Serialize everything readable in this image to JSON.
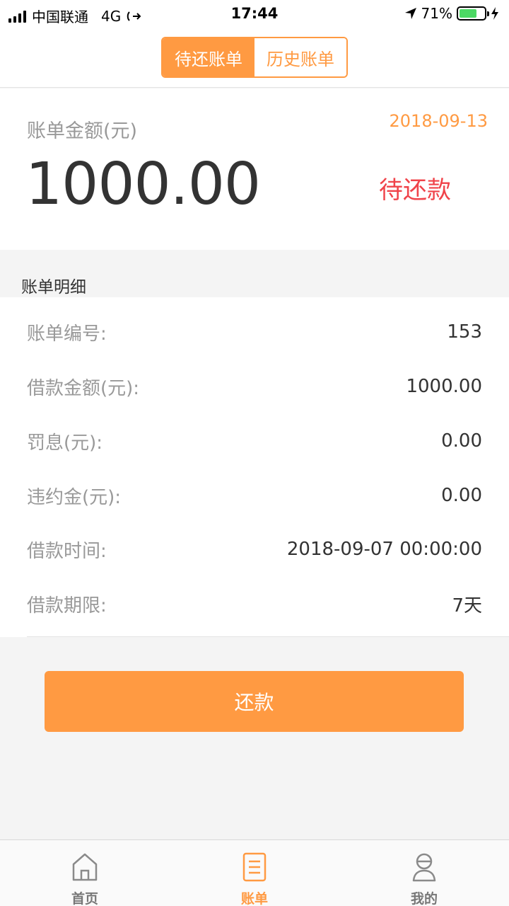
{
  "status_bar": {
    "carrier": "中国联通",
    "network": "4G",
    "time": "17:44",
    "battery_percent": "71%",
    "battery_level": 0.71,
    "battery_color": "#4cd964"
  },
  "header": {
    "tabs": [
      {
        "label": "待还账单",
        "active": true
      },
      {
        "label": "历史账单",
        "active": false
      }
    ]
  },
  "summary": {
    "label": "账单金额(元)",
    "date": "2018-09-13",
    "amount": "1000.00",
    "status": "待还款"
  },
  "details": {
    "title": "账单明细",
    "rows": [
      {
        "label": "账单编号:",
        "value": "153"
      },
      {
        "label": "借款金额(元):",
        "value": "1000.00"
      },
      {
        "label": "罚息(元):",
        "value": "0.00"
      },
      {
        "label": "违约金(元):",
        "value": "0.00"
      },
      {
        "label": "借款时间:",
        "value": "2018-09-07 00:00:00"
      },
      {
        "label": "借款期限:",
        "value": "7天"
      }
    ]
  },
  "action": {
    "repay_label": "还款"
  },
  "tabbar": {
    "items": [
      {
        "label": "首页",
        "icon": "home-icon",
        "active": false
      },
      {
        "label": "账单",
        "icon": "bill-icon",
        "active": true
      },
      {
        "label": "我的",
        "icon": "profile-icon",
        "active": false
      }
    ]
  },
  "colors": {
    "accent": "#ff9a42",
    "status_red": "#f0434a",
    "background": "#f4f4f4"
  }
}
